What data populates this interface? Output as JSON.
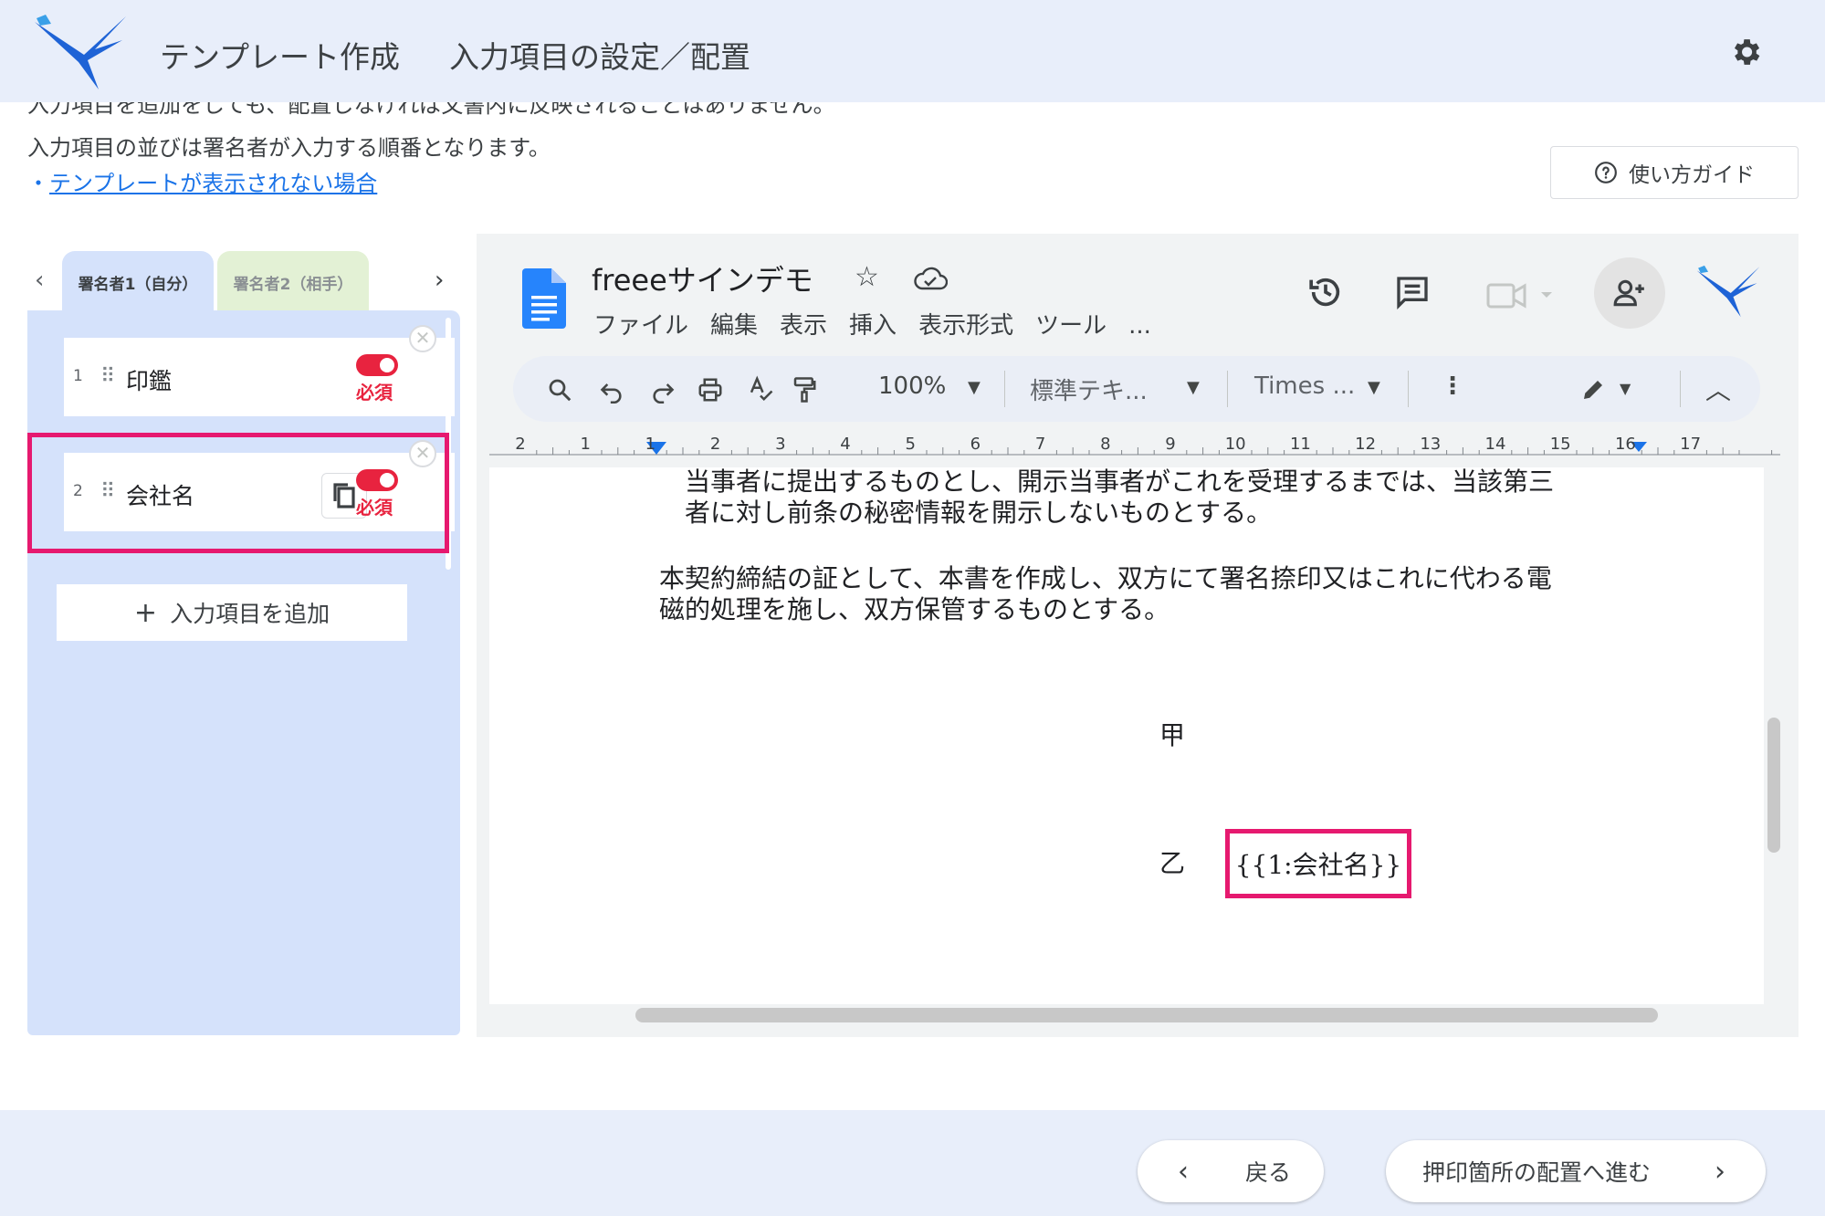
{
  "header": {
    "title": "テンプレート作成",
    "subtitle": "入力項目の設定／配置",
    "settings_icon": "gear-icon",
    "logo_icon": "bird-logo-icon"
  },
  "info": {
    "line_clipped": "入力項目を追加をしても、配置しなければ文書内に反映されることはありません。",
    "line2": "入力項目の並びは署名者が入力する順番となります。",
    "link_bullet": "・",
    "link_text": "テンプレートが表示されない場合"
  },
  "guide_button": {
    "label": "使い方ガイド",
    "icon": "help-circle-icon"
  },
  "signer_tabs": [
    {
      "label": "署名者1（自分）",
      "color": "#d5e2fb"
    },
    {
      "label": "署名者2（相手）",
      "color": "#e3f1d5"
    }
  ],
  "fields": [
    {
      "num": "1",
      "label": "印鑑",
      "required": "必須"
    },
    {
      "num": "2",
      "label": "会社名",
      "required": "必須"
    }
  ],
  "add_field_button": {
    "icon": "plus-icon",
    "label": "入力項目を追加"
  },
  "doc": {
    "title": "freeeサインデモ",
    "menu": [
      "ファイル",
      "編集",
      "表示",
      "挿入",
      "表示形式",
      "ツール",
      "..."
    ],
    "toolbar": {
      "zoom": "100%",
      "style": "標準テキ...",
      "font": "Times ..."
    },
    "ruler": [
      "2",
      "1",
      "1",
      "2",
      "3",
      "4",
      "5",
      "6",
      "7",
      "8",
      "9",
      "10",
      "11",
      "12",
      "13",
      "14",
      "15",
      "16",
      "17"
    ],
    "lines": [
      "当事者に提出するものとし、開示当事者がこれを受理するまでは、当該第三",
      "者に対し前条の秘密情報を開示しないものとする。",
      "本契約締結の証として、本書を作成し、双方にて署名捺印又はこれに代わる電",
      "磁的処理を施し、双方保管するものとする。"
    ],
    "party_a": "甲",
    "party_b": "乙",
    "placeholder": "{{1:会社名}}"
  },
  "footer": {
    "back_label": "戻る",
    "next_label": "押印箇所の配置へ進む"
  },
  "colors": {
    "highlight": "#e6196f",
    "toggle_on": "#e8233f",
    "panel_blue": "#d5e2fb",
    "header_bg": "#e8eefa"
  }
}
